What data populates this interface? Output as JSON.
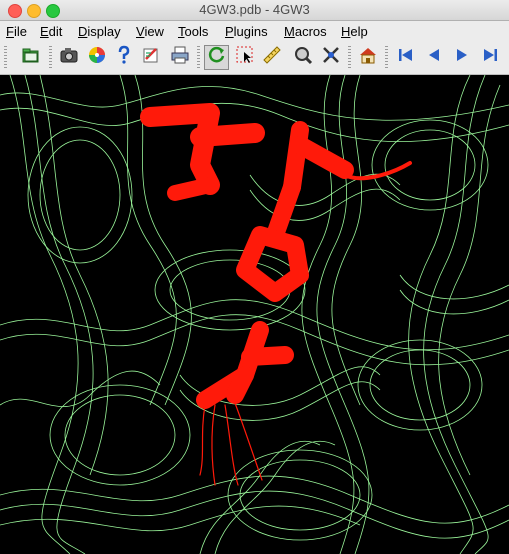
{
  "window": {
    "title": "4GW3.pdb - 4GW3"
  },
  "menu": {
    "items": [
      {
        "mnemonic": "F",
        "rest": "ile"
      },
      {
        "mnemonic": "E",
        "rest": "dit"
      },
      {
        "mnemonic": "D",
        "rest": "isplay"
      },
      {
        "mnemonic": "V",
        "rest": "iew"
      },
      {
        "mnemonic": "T",
        "rest": "ools"
      },
      {
        "mnemonic": "P",
        "rest": "lugins"
      },
      {
        "mnemonic": "M",
        "rest": "acros"
      },
      {
        "mnemonic": "H",
        "rest": "elp"
      }
    ]
  },
  "toolbar": {
    "icons": [
      "open-icon",
      "camera-icon",
      "color-wheel-icon",
      "help-icon",
      "edit-script-icon",
      "print-icon",
      "rotate-icon",
      "select-icon",
      "measure-icon",
      "zoom-icon",
      "pick-center-icon",
      "home-icon",
      "first-frame-icon",
      "previous-frame-icon",
      "next-frame-icon",
      "last-frame-icon"
    ]
  },
  "viewer": {
    "description_colors": {
      "mesh": "#9af59a",
      "ligand": "#ff0000",
      "background": "#000000"
    }
  }
}
